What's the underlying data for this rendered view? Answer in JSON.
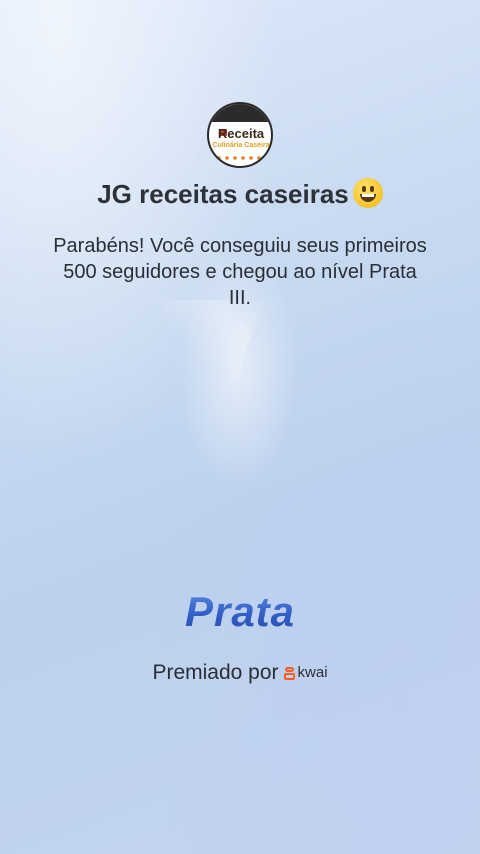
{
  "profile": {
    "avatar_line1": "Receita",
    "avatar_line2": "Culinária Caseira",
    "name": "JG receitas caseiras",
    "emoji_icon": "grinning-face-icon"
  },
  "message": "Parabéns! Você conseguiu seus primeiros 500 seguidores e chegou ao nível Prata III.",
  "level_label": "Prata",
  "awarded": {
    "prefix": "Premiado por",
    "brand": "kwai",
    "brand_icon": "kwai-logo-icon",
    "brand_color": "#ff5a1f"
  },
  "colors": {
    "background": "#c6d8f1",
    "level_text": "#3563c8",
    "text": "#2a2e35"
  }
}
